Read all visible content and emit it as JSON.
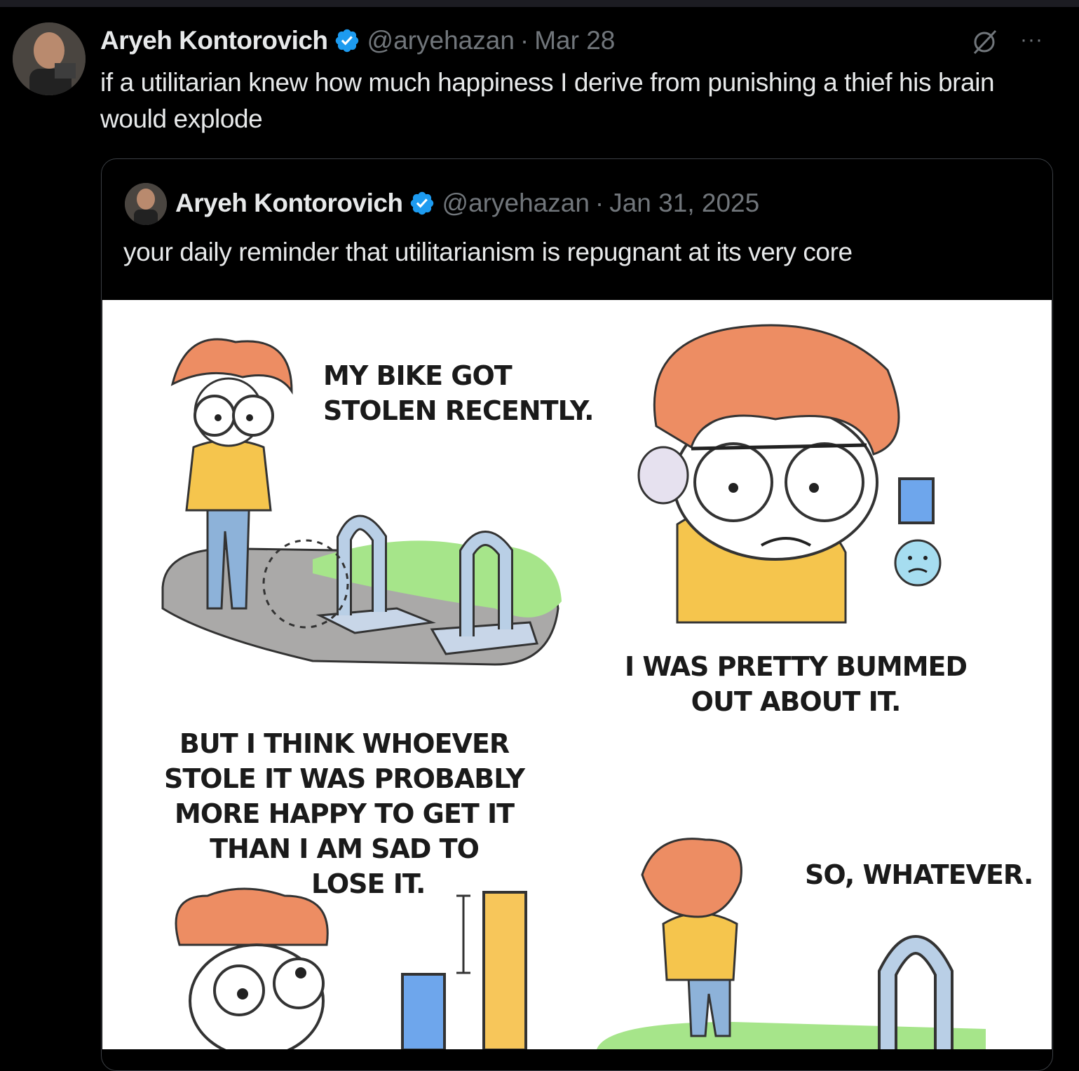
{
  "tweet": {
    "author_name": "Aryeh Kontorovich",
    "handle": "@aryehazan",
    "separator": "·",
    "date": "Mar 28",
    "text": "if a utilitarian knew how much happiness I derive from punishing a thief his brain would explode"
  },
  "quoted_tweet": {
    "author_name": "Aryeh Kontorovich",
    "handle": "@aryehazan",
    "separator": "·",
    "date": "Jan 31, 2025",
    "text": "your daily reminder that utilitarianism is repugnant at its very core"
  },
  "comic": {
    "panel1_caption_line1": "MY BIKE GOT",
    "panel1_caption_line2": "STOLEN RECENTLY.",
    "panel2_caption_line1": "I WAS PRETTY BUMMED",
    "panel2_caption_line2": "OUT ABOUT IT.",
    "panel3_caption_line1": "BUT I THINK WHOEVER",
    "panel3_caption_line2": "STOLE IT WAS PROBABLY",
    "panel3_caption_line3": "MORE HAPPY TO GET IT",
    "panel3_caption_line4": "THAN I AM SAD TO",
    "panel3_caption_line5": "LOSE IT.",
    "panel4_caption": "SO, WHATEVER."
  },
  "icons": {
    "verified_badge": "verified-icon",
    "grok": "grok-icon",
    "more": "more-icon"
  },
  "colors": {
    "background": "#000000",
    "text": "#e7e9ea",
    "muted": "#71767b",
    "verified": "#1d9bf0",
    "card_border": "#3b3f44"
  }
}
